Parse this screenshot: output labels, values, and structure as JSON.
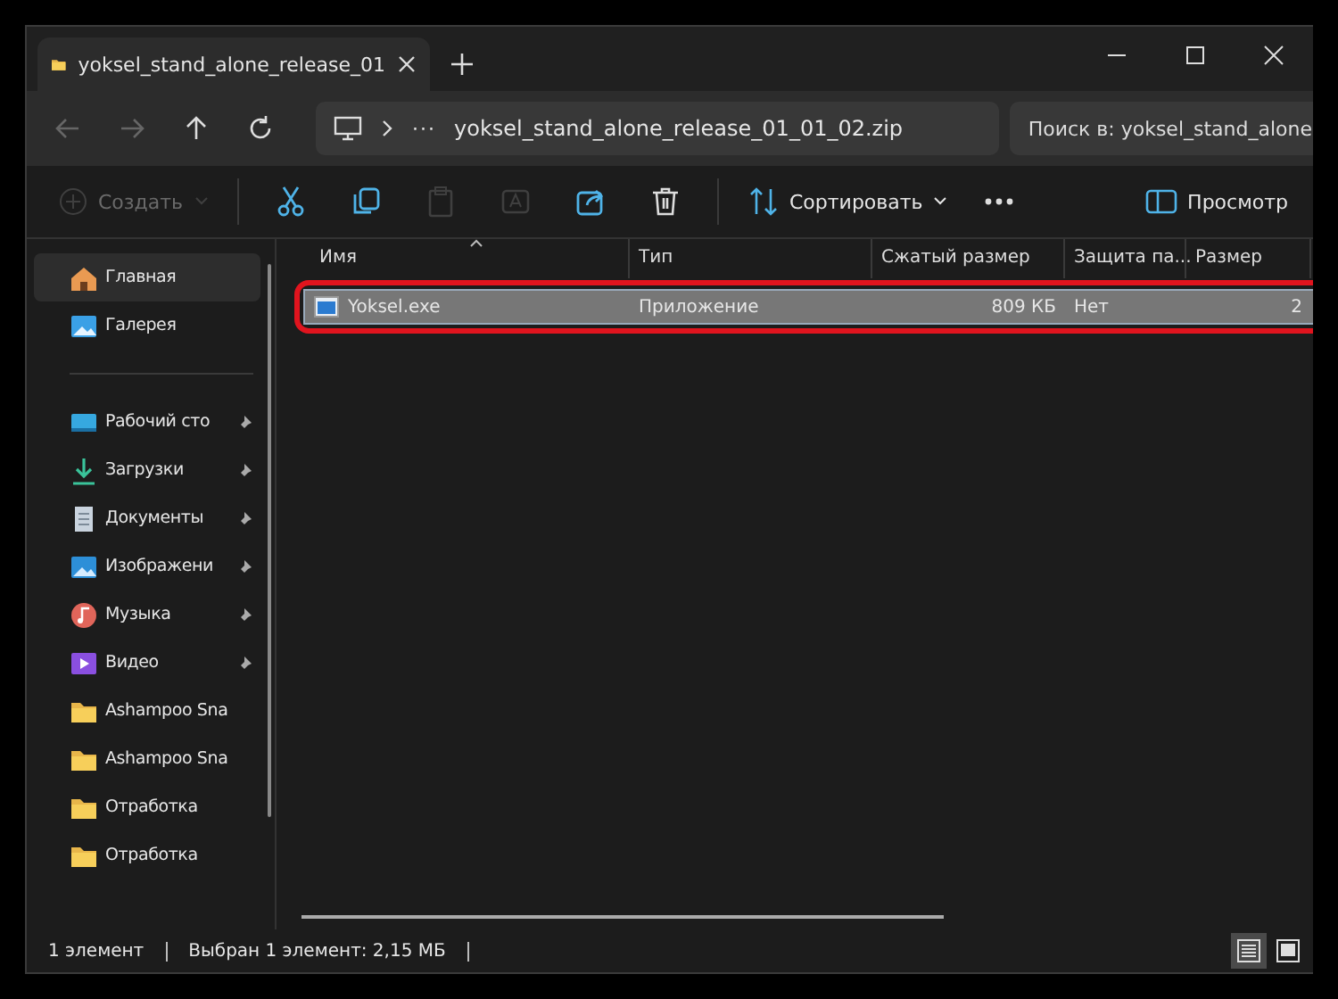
{
  "tab": {
    "title": "yoksel_stand_alone_release_01",
    "selected": true
  },
  "nav": {
    "back_disabled": true,
    "forward_disabled": true
  },
  "address": {
    "path": "yoksel_stand_alone_release_01_01_02.zip",
    "ellipsis": "···"
  },
  "search": {
    "placeholder": "Поиск в: yoksel_stand_alone"
  },
  "toolbar": [
    {
      "kind": "new",
      "label": "Создать",
      "disabled": true
    },
    {
      "kind": "cut",
      "disabled": false
    },
    {
      "kind": "copy",
      "disabled": false
    },
    {
      "kind": "paste",
      "disabled": true
    },
    {
      "kind": "rename",
      "disabled": true
    },
    {
      "kind": "share",
      "disabled": false
    },
    {
      "kind": "delete",
      "disabled": false
    },
    {
      "kind": "sort",
      "label": "Сортировать",
      "disabled": false
    },
    {
      "kind": "more",
      "disabled": false
    }
  ],
  "preview_button": {
    "label": "Просмотр"
  },
  "sidebar": {
    "groups": [
      [
        {
          "kind": "home",
          "label": "Главная",
          "selected": true,
          "pinned": false
        },
        {
          "kind": "gallery",
          "label": "Галерея",
          "selected": false,
          "pinned": false
        }
      ],
      [
        {
          "kind": "desktop",
          "label": "Рабочий сто",
          "selected": false,
          "pinned": true
        },
        {
          "kind": "downloads",
          "label": "Загрузки",
          "selected": false,
          "pinned": true
        },
        {
          "kind": "documents",
          "label": "Документы",
          "selected": false,
          "pinned": true
        },
        {
          "kind": "pictures",
          "label": "Изображени",
          "selected": false,
          "pinned": true
        },
        {
          "kind": "music",
          "label": "Музыка",
          "selected": false,
          "pinned": true
        },
        {
          "kind": "video",
          "label": "Видео",
          "selected": false,
          "pinned": true
        },
        {
          "kind": "folder",
          "label": "Ashampoo Sna",
          "selected": false,
          "pinned": false
        },
        {
          "kind": "folder",
          "label": "Ashampoo Sna",
          "selected": false,
          "pinned": false
        },
        {
          "kind": "folder",
          "label": "Отработка",
          "selected": false,
          "pinned": false
        },
        {
          "kind": "folder",
          "label": "Отработка",
          "selected": false,
          "pinned": false
        }
      ]
    ]
  },
  "table": {
    "columns": [
      "Имя",
      "Тип",
      "Сжатый размер",
      "Защита па...",
      "Размер"
    ],
    "rows": [
      {
        "cells": [
          "Yoksel.exe",
          "Приложение",
          "809 КБ",
          "Нет",
          "2"
        ],
        "selected": true,
        "highlighted": true
      }
    ]
  },
  "status_bar": {
    "count": "1 элемент",
    "selection": "Выбран 1 элемент: 2,15 МБ"
  },
  "view_buttons": [
    {
      "kind": "details",
      "selected": true
    },
    {
      "kind": "tiles",
      "selected": false
    }
  ]
}
